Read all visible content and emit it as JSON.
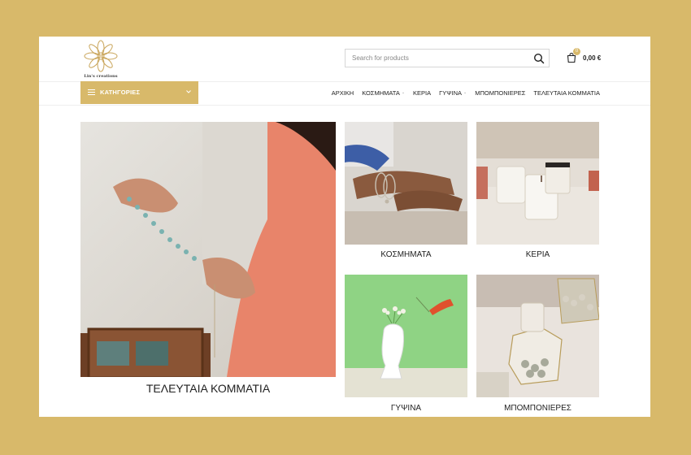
{
  "brand": {
    "logo_text": "Lin's creations",
    "accent_color": "#d8b96a"
  },
  "search": {
    "placeholder": "Search for products"
  },
  "cart": {
    "count": "0",
    "total": "0,00 €"
  },
  "categories_button": {
    "label": "ΚΑΤΗΓΟΡΙΕΣ"
  },
  "menu": {
    "items": [
      {
        "label": "ΑΡΧΙΚΗ"
      },
      {
        "label": "ΚΟΣΜΗΜΑΤΑ"
      },
      {
        "label": "ΚΕΡΙΑ"
      },
      {
        "label": "ΓΥΨΙΝΑ"
      },
      {
        "label": "ΜΠΟΜΠΟΝΙΕΡΕΣ"
      },
      {
        "label": "ΤΕΛΕΥΤΑΙΑ ΚΟΜΜΑΤΙΑ"
      }
    ]
  },
  "tiles": {
    "featured": {
      "label": "ΤΕΛΕΥΤΑΙΑ ΚΟΜΜΑΤΙΑ"
    },
    "jewelry": {
      "label": "ΚΟΣΜΗΜΑΤΑ"
    },
    "candles": {
      "label": "ΚΕΡΙΑ"
    },
    "plaster": {
      "label": "ΓΥΨΙΝΑ"
    },
    "favors": {
      "label": "ΜΠΟΜΠΟΝΙΕΡΕΣ"
    }
  }
}
